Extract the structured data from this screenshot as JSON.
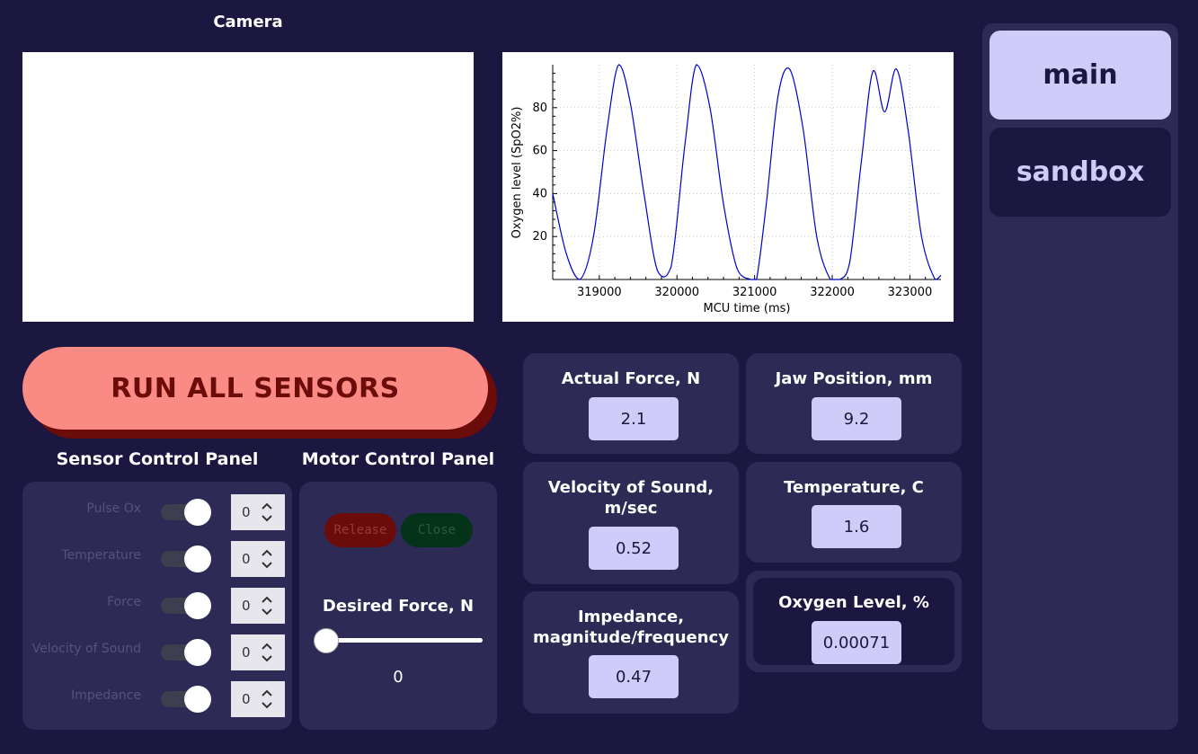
{
  "camera": {
    "title": "Camera"
  },
  "chart_data": {
    "type": "line",
    "xlabel": "MCU time (ms)",
    "ylabel": "Oxygen level (SpO2%)",
    "xlim": [
      318400,
      323400
    ],
    "ylim": [
      0,
      100
    ],
    "xticks": [
      319000,
      320000,
      321000,
      322000,
      323000
    ],
    "yticks": [
      20,
      40,
      60,
      80
    ],
    "grid": true,
    "line_color": "#0000cc",
    "series": [
      {
        "x": [
          318400,
          318575,
          318750,
          318925,
          319100,
          319250,
          319400,
          319575,
          319750,
          319925,
          320100,
          320250,
          320425,
          320600,
          320775,
          320950,
          321025,
          321150,
          321300,
          321450,
          321625,
          321800,
          321975,
          322100,
          322225,
          322375,
          322525,
          322675,
          322825,
          322975,
          323150,
          323325,
          323400
        ],
        "y": [
          40,
          12,
          0,
          20,
          70,
          100,
          82,
          40,
          4,
          6,
          62,
          100,
          80,
          35,
          5,
          0,
          0,
          35,
          85,
          98,
          70,
          20,
          0,
          0,
          8,
          55,
          97,
          78,
          98,
          70,
          20,
          0,
          2
        ]
      }
    ]
  },
  "run_button": {
    "label": "RUN ALL SENSORS"
  },
  "sensor_panel": {
    "title": "Sensor Control Panel",
    "rows": [
      {
        "label": "Pulse Ox",
        "value": "0"
      },
      {
        "label": "Temperature",
        "value": "0"
      },
      {
        "label": "Force",
        "value": "0"
      },
      {
        "label": "Velocity of Sound",
        "value": "0"
      },
      {
        "label": "Impedance",
        "value": "0"
      }
    ]
  },
  "motor_panel": {
    "title": "Motor Control Panel",
    "release_label": "Release",
    "close_label": "Close",
    "force_title": "Desired Force, N",
    "force_value": "0",
    "force_level": 0
  },
  "readings": {
    "actual_force": {
      "title": "Actual Force, N",
      "value": "2.1"
    },
    "jaw_position": {
      "title": "Jaw Position, mm",
      "value": "9.2"
    },
    "velocity": {
      "title_line1": "Velocity of Sound,",
      "title_line2": "m/sec",
      "value": "0.52"
    },
    "temperature": {
      "title": "Temperature, C",
      "value": "1.6"
    },
    "impedance": {
      "title_line1": "Impedance,",
      "title_line2": "magnitude/frequency",
      "value": "0.47"
    },
    "oxygen": {
      "title": "Oxygen Level, %",
      "value": "0.00071"
    }
  },
  "nav": {
    "main_label": "main",
    "sandbox_label": "sandbox"
  },
  "colors": {
    "background": "#1c1740",
    "panel": "#2d2b55",
    "accent": "#d0cbf9",
    "run": "#fa8a84",
    "run_shadow": "#6b0c0a"
  }
}
